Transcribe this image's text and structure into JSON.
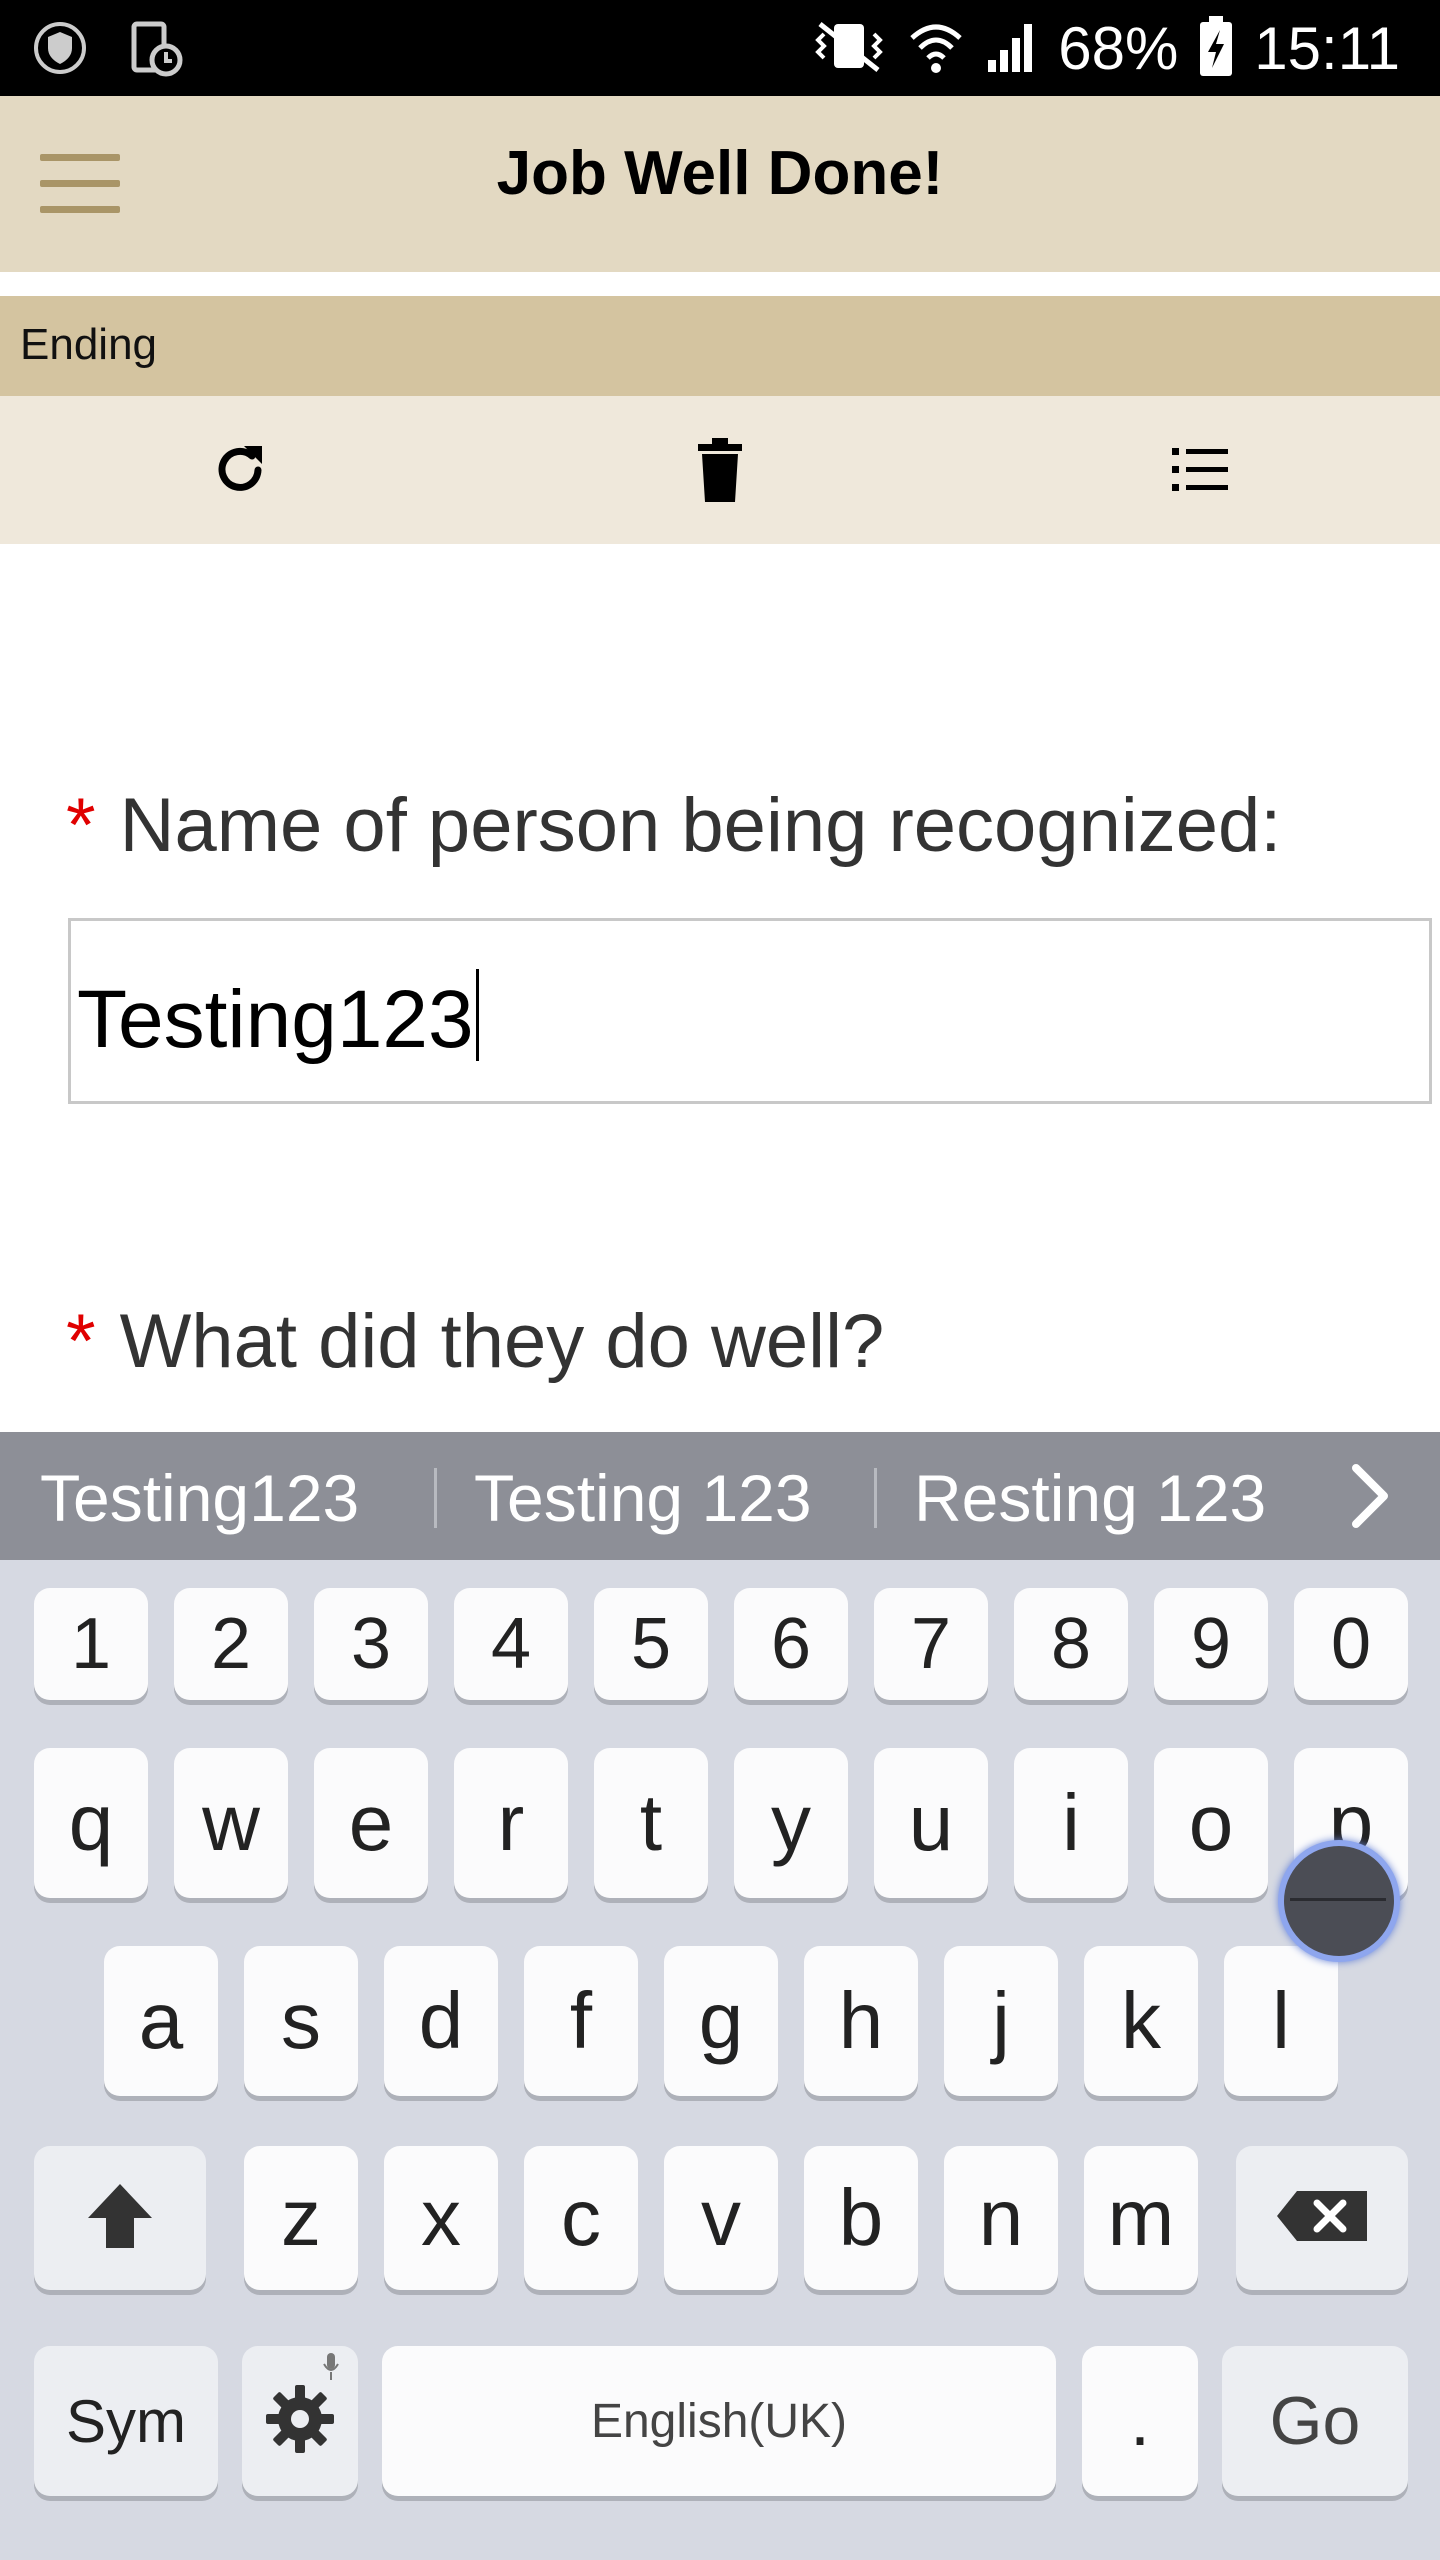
{
  "status_bar": {
    "battery_percent": "68%",
    "time": "15:11",
    "icons": [
      "shield-icon",
      "tablet-clock-icon",
      "vibrate-mute-icon",
      "wifi-icon",
      "signal-icon",
      "battery-charging-icon"
    ]
  },
  "app_bar": {
    "title": "Job Well Done!",
    "menu_icon": "hamburger-menu-icon",
    "accent_color": "#a99567",
    "background": "#e3d9c2"
  },
  "section": {
    "label": "Ending",
    "background": "#d4c4a0"
  },
  "toolbar": {
    "buttons": [
      {
        "icon": "refresh-icon"
      },
      {
        "icon": "trash-icon"
      },
      {
        "icon": "list-icon"
      }
    ]
  },
  "form": {
    "required_marker": "*",
    "questions": [
      {
        "label": "Name of person being recognized:",
        "value": "Testing123"
      },
      {
        "label": "What did they do well?"
      }
    ]
  },
  "keyboard": {
    "suggestions": [
      "Testing123",
      "Testing 123",
      "Resting 123"
    ],
    "number_row": [
      "1",
      "2",
      "3",
      "4",
      "5",
      "6",
      "7",
      "8",
      "9",
      "0"
    ],
    "row1": [
      "q",
      "w",
      "e",
      "r",
      "t",
      "y",
      "u",
      "i",
      "o",
      "p"
    ],
    "row2": [
      "a",
      "s",
      "d",
      "f",
      "g",
      "h",
      "j",
      "k",
      "l"
    ],
    "row3": [
      "z",
      "x",
      "c",
      "v",
      "b",
      "n",
      "m"
    ],
    "sym_label": "Sym",
    "space_label": "English(UK)",
    "period_label": ".",
    "go_label": "Go"
  }
}
